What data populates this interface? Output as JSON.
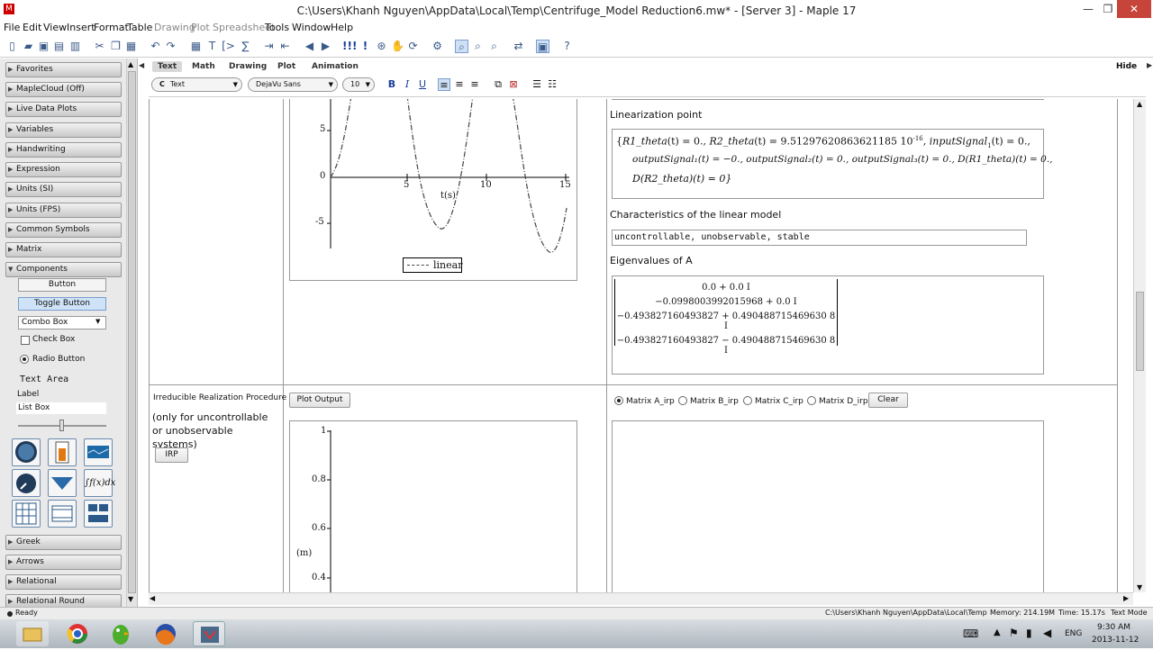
{
  "window": {
    "title": "C:\\Users\\Khanh Nguyen\\AppData\\Local\\Temp\\Centrifuge_Model Reduction6.mw* - [Server 3] - Maple 17",
    "minimize": "—",
    "restore": "❐",
    "close": "✕"
  },
  "menu": [
    "File",
    "Edit",
    "View",
    "Insert",
    "Format",
    "Table",
    "Drawing",
    "Plot",
    "Spreadsheet",
    "Tools",
    "Window",
    "Help"
  ],
  "context_bar": {
    "tabs": [
      "Text",
      "Math",
      "Drawing",
      "Plot",
      "Animation"
    ],
    "active_tab": "Text",
    "style_value": "Text",
    "font_value": "DejaVu Sans",
    "size_value": "10",
    "hide": "Hide",
    "bold": "B",
    "italic": "I",
    "underline": "U"
  },
  "palettes": {
    "sections_top": [
      "Favorites",
      "MapleCloud (Off)",
      "Live Data Plots",
      "Variables",
      "Handwriting",
      "Expression",
      "Units (SI)",
      "Units (FPS)",
      "Common Symbols",
      "Matrix",
      "Components"
    ],
    "components": {
      "button": "Button",
      "toggle": "Toggle Button",
      "combo": "Combo Box",
      "checkbox": "Check Box",
      "radio": "Radio Button",
      "textarea": "Text Area",
      "label": "Label",
      "listbox": "List Box"
    },
    "sections_bottom": [
      "Greek",
      "Arrows",
      "Relational",
      "Relational Round"
    ]
  },
  "plot1": {
    "y_ticks": [
      "5",
      "0",
      "-5"
    ],
    "x_ticks": [
      "5",
      "10",
      "15"
    ],
    "x_label": "t(s)",
    "legend": "linear"
  },
  "right_panel": {
    "linearization_title": "Linearization point",
    "lin_line1_a": "R1_theta",
    "lin_line1_b": "(t) = 0., ",
    "lin_line1_c": "R2_theta",
    "lin_line1_d": "(t) = 9.51297620863621185 10",
    "lin_line1_exp": "-16",
    "lin_line1_e": ", inputSignal",
    "lin_line1_sub": "1",
    "lin_line1_f": "(t) = 0.,",
    "lin_line2": "outputSignal₁(t) = −0., outputSignal₂(t) = 0., outputSignal₃(t) = 0., D(R1_theta)(t) = 0.,",
    "lin_line3": "D(R2_theta)(t) = 0}",
    "characteristics_title": "Characteristics of the linear model",
    "characteristics_value": "uncontrollable, unobservable, stable",
    "eigen_title": "Eigenvalues of A",
    "eigenvalues": [
      "0.0 + 0.0 I",
      "−0.0998003992015968 + 0.0 I",
      "−0.493827160493827 + 0.490488715469630 8 I",
      "−0.493827160493827 − 0.490488715469630 8 I"
    ]
  },
  "irp": {
    "title": "Irreducible Realization Procedure",
    "note": "(only for uncontrollable or unobservable systems)",
    "button": "IRP",
    "plot_button": "Plot Output",
    "radios": [
      "Matrix A_irp",
      "Matrix B_irp",
      "Matrix C_irp",
      "Matrix D_irp"
    ],
    "clear": "Clear",
    "y_ticks": [
      "1",
      "0.8",
      "0.6",
      "0.4"
    ],
    "y_label": "(m)"
  },
  "status": {
    "ready": "Ready",
    "path": "C:\\Users\\Khanh Nguyen\\AppData\\Local\\Temp",
    "memory": "Memory: 214.19M",
    "time": "Time: 15.17s",
    "mode": "Text Mode"
  },
  "tray": {
    "lang": "ENG",
    "clock": "9:30 AM",
    "date": "2013-11-12"
  }
}
